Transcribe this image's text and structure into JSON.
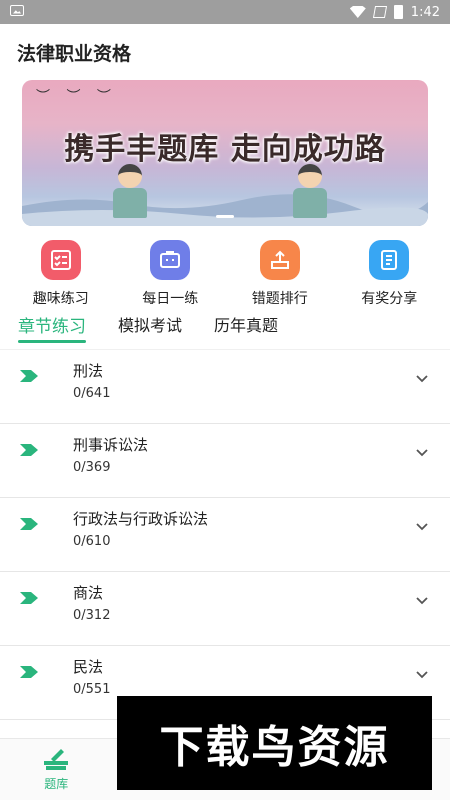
{
  "status": {
    "time": "1:42"
  },
  "app": {
    "title": "法律职业资格"
  },
  "banner": {
    "text": "携手丰题库 走向成功路"
  },
  "quick": [
    {
      "label": "趣味练习",
      "color": "#f25c6a",
      "icon": "checklist-icon"
    },
    {
      "label": "每日一练",
      "color": "#6f7ee8",
      "icon": "briefcase-icon"
    },
    {
      "label": "错题排行",
      "color": "#f7864a",
      "icon": "upload-tray-icon"
    },
    {
      "label": "有奖分享",
      "color": "#38a6f3",
      "icon": "notebook-icon"
    }
  ],
  "tabs": [
    {
      "label": "章节练习",
      "active": true
    },
    {
      "label": "模拟考试",
      "active": false
    },
    {
      "label": "历年真题",
      "active": false
    }
  ],
  "chapters": [
    {
      "name": "刑法",
      "count": "0/641"
    },
    {
      "name": "刑事诉讼法",
      "count": "0/369"
    },
    {
      "name": "行政法与行政诉讼法",
      "count": "0/610"
    },
    {
      "name": "商法",
      "count": "0/312"
    },
    {
      "name": "民法",
      "count": "0/551"
    }
  ],
  "nav": {
    "items": [
      {
        "label": "题库"
      }
    ]
  },
  "watermark": {
    "text": "下载鸟资源"
  },
  "colors": {
    "accent": "#2ab57d"
  }
}
